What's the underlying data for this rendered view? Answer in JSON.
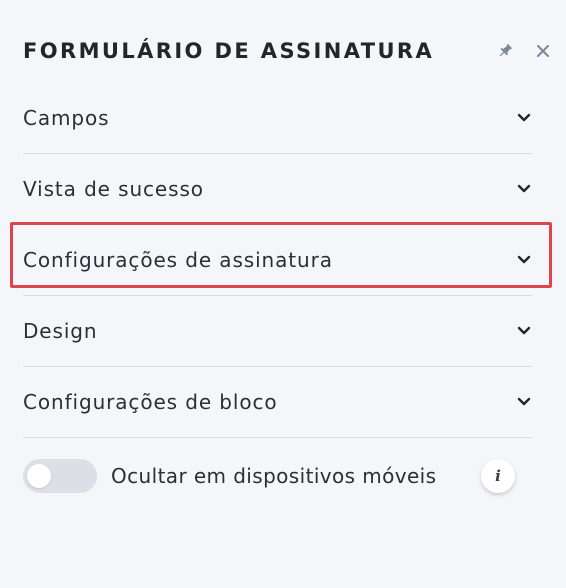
{
  "panel": {
    "title": "FORMULÁRIO DE ASSINATURA",
    "icons": {
      "pin": "pin-icon",
      "close": "close-icon"
    }
  },
  "sections": [
    {
      "label": "Campos",
      "expanded": false,
      "highlighted": false
    },
    {
      "label": "Vista de sucesso",
      "expanded": false,
      "highlighted": false
    },
    {
      "label": "Configurações de assinatura",
      "expanded": false,
      "highlighted": true
    },
    {
      "label": "Design",
      "expanded": false,
      "highlighted": false
    },
    {
      "label": "Configurações de bloco",
      "expanded": false,
      "highlighted": false
    }
  ],
  "toggle": {
    "label": "Ocultar em dispositivos móveis",
    "checked": false,
    "info_icon": "info-icon",
    "info_glyph": "i"
  },
  "colors": {
    "background": "#f5f6fa",
    "highlight": "#e0434b",
    "divider": "#d9dbe0",
    "toggle_off": "#dcdfe5",
    "icon": "#7a8799"
  }
}
